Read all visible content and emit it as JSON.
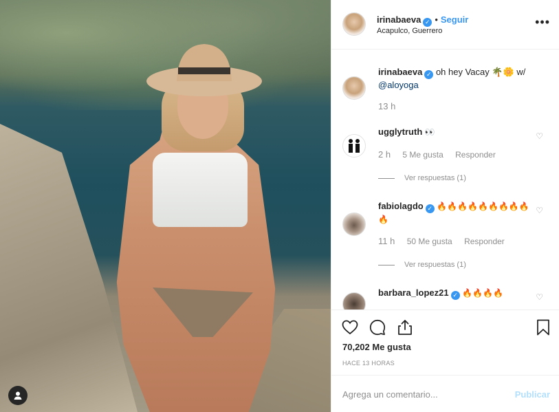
{
  "post": {
    "image_alt": "Photo",
    "profile_tag_icon": "user-tag-icon"
  },
  "header": {
    "username": "irinabaeva",
    "separator": "•",
    "follow_label": "Seguir",
    "location": "Acapulco, Guerrero",
    "more_label": "•••"
  },
  "caption": {
    "username": "irinabaeva",
    "text": "oh hey Vacay 🌴🌼 w/",
    "mention": "@aloyoga",
    "time": "13 h"
  },
  "comments": [
    {
      "username": "ugglytruth",
      "verified": false,
      "text": "👀",
      "time": "2 h",
      "likes": "5 Me gusta",
      "reply": "Responder",
      "view_replies": "Ver respuestas (1)"
    },
    {
      "username": "fabiolagdo",
      "verified": true,
      "text": "🔥🔥🔥🔥🔥🔥🔥🔥🔥🔥",
      "time": "11 h",
      "likes": "50 Me gusta",
      "reply": "Responder",
      "view_replies": "Ver respuestas (1)"
    },
    {
      "username": "barbara_lopez21",
      "verified": true,
      "text": "🔥🔥🔥🔥",
      "time": "",
      "likes": "",
      "reply": "",
      "view_replies": ""
    }
  ],
  "actions": {
    "like_icon": "heart-icon",
    "comment_icon": "comment-icon",
    "share_icon": "share-icon",
    "save_icon": "bookmark-icon",
    "likes_count": "70,202 Me gusta",
    "time_ago": "HACE 13 HORAS"
  },
  "composer": {
    "placeholder": "Agrega un comentario...",
    "post_label": "Publicar"
  },
  "colors": {
    "accent": "#3897f0",
    "post_disabled": "#b2dffc",
    "muted_text": "#8e8e8e",
    "fire": "#f4511e"
  }
}
